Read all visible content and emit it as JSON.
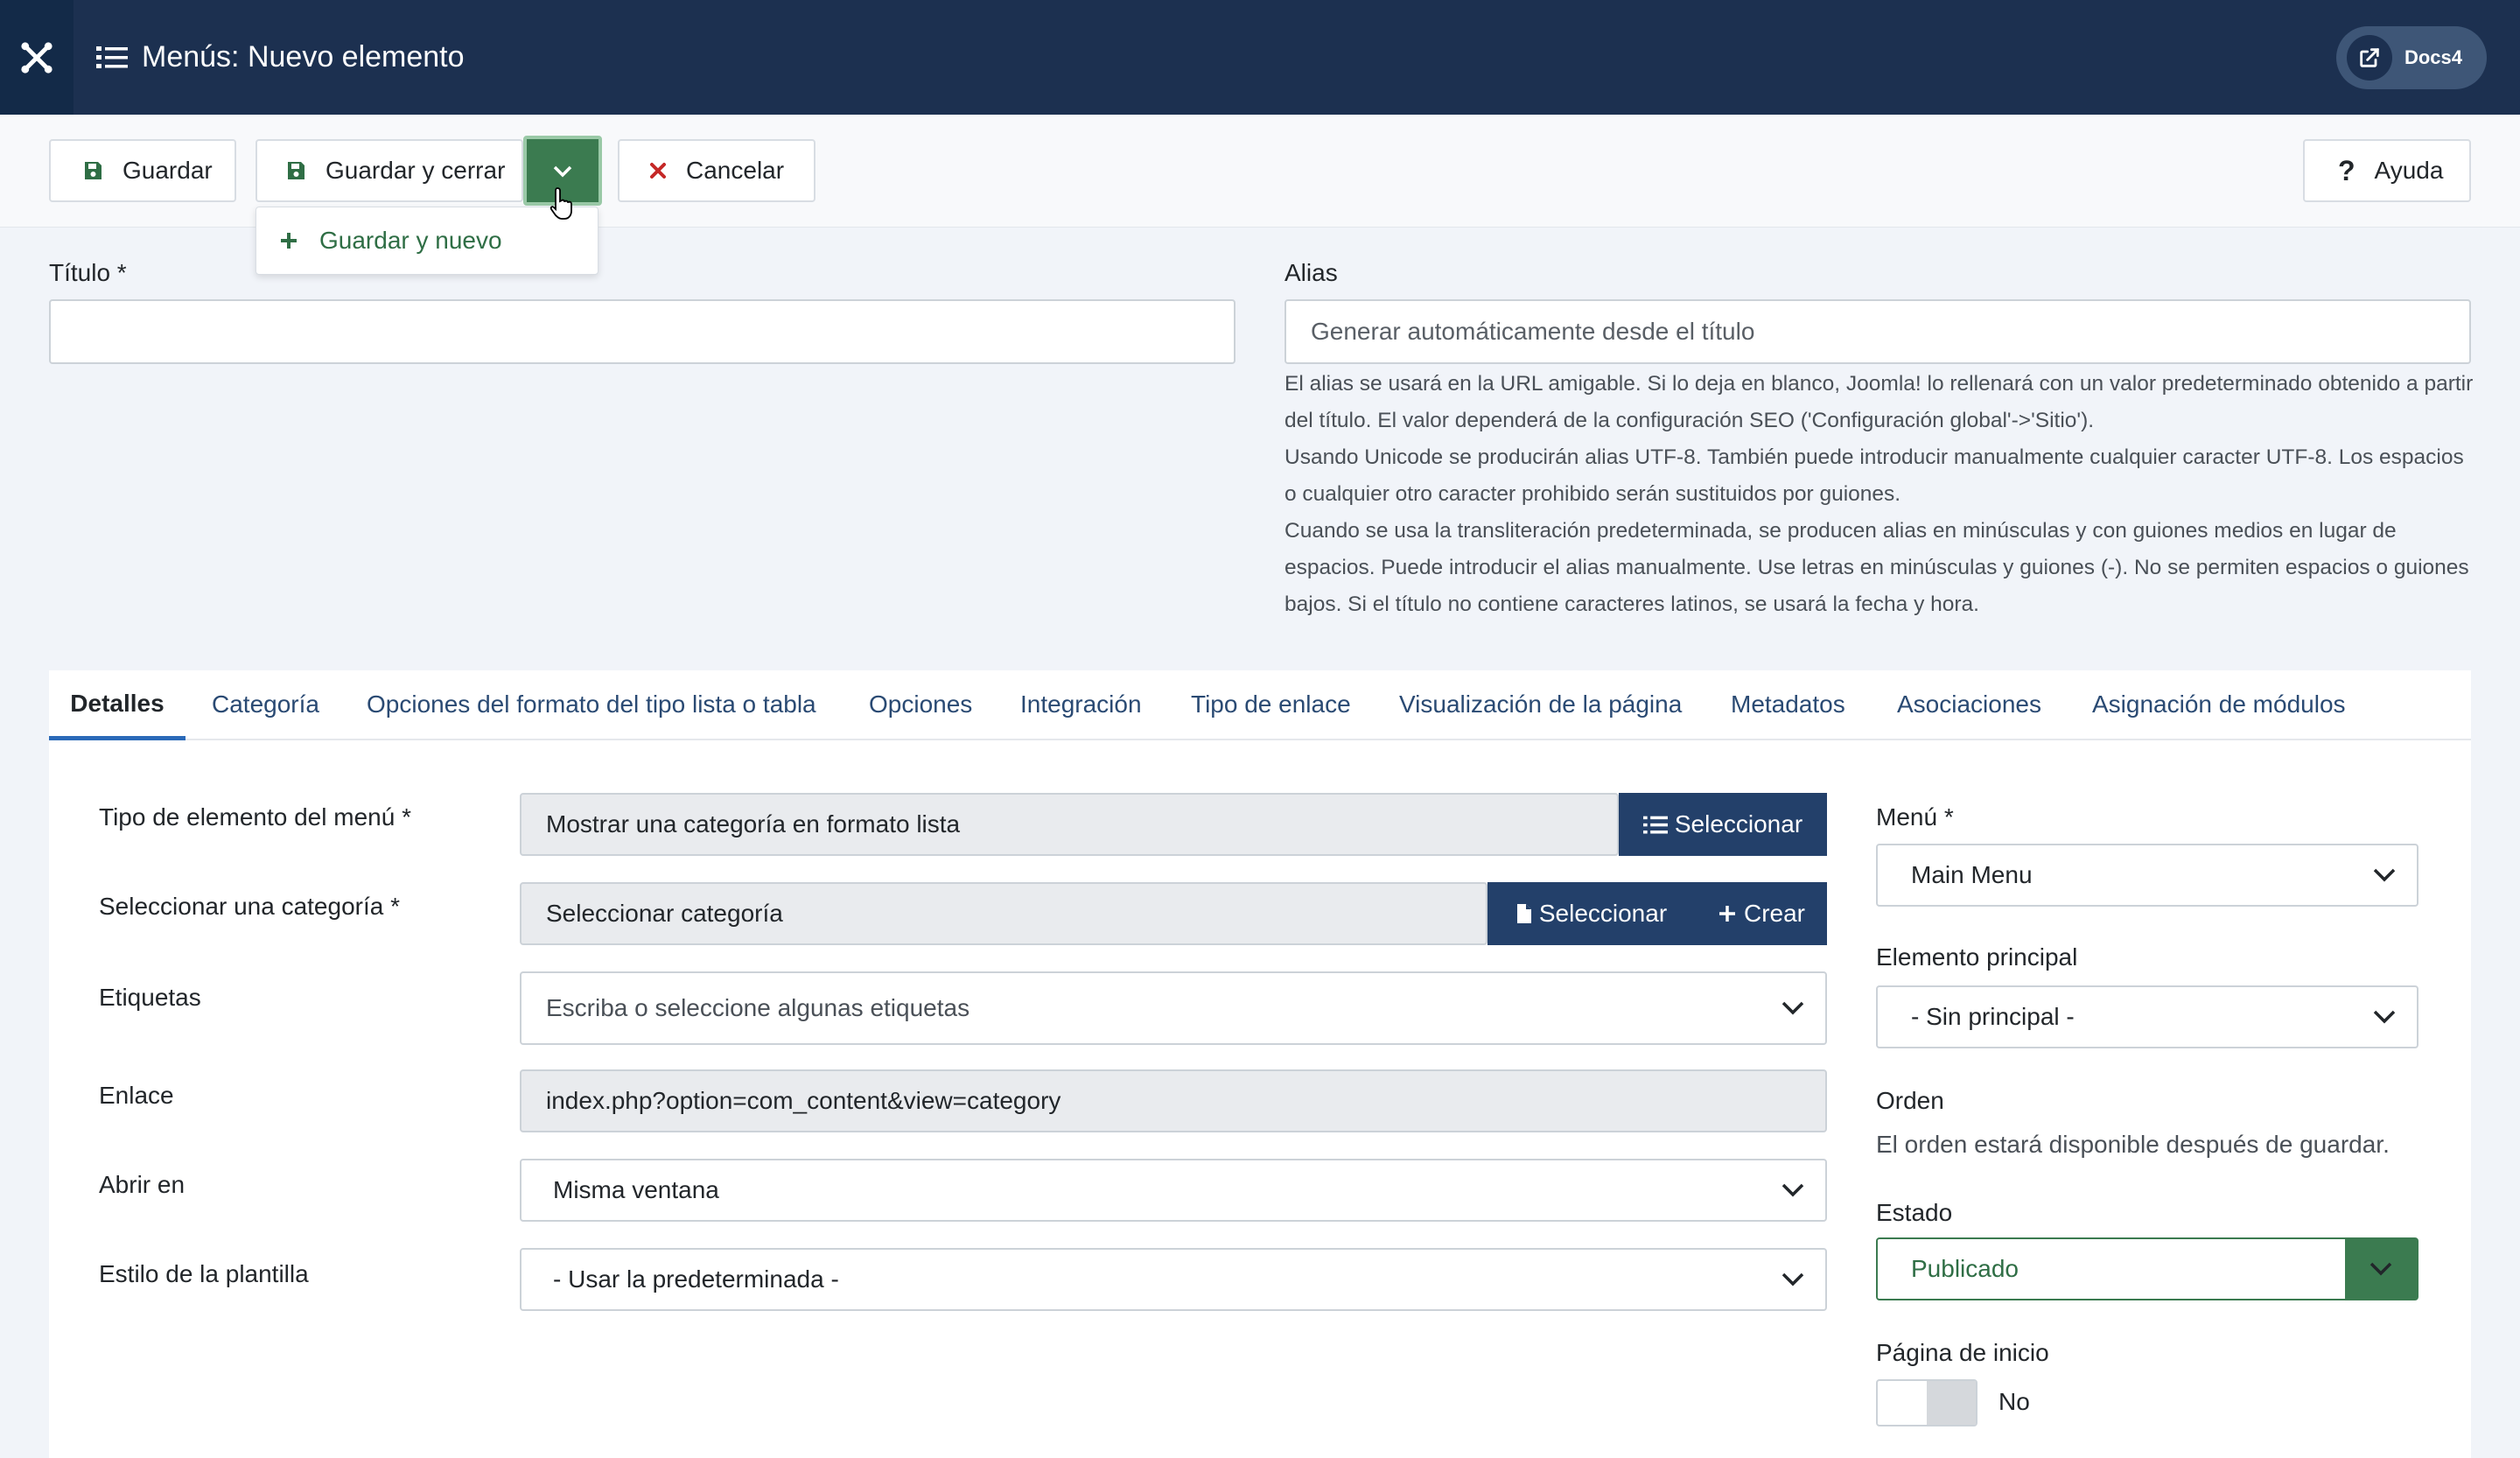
{
  "header": {
    "title": "Menús: Nuevo elemento",
    "docs_label": "Docs4"
  },
  "toolbar": {
    "save_label": "Guardar",
    "save_close_label": "Guardar y cerrar",
    "cancel_label": "Cancelar",
    "help_label": "Ayuda",
    "dropdown_item": "Guardar y nuevo"
  },
  "form": {
    "title_label": "Título *",
    "title_value": "",
    "alias_label": "Alias",
    "alias_placeholder": "Generar automáticamente desde el título",
    "alias_help": [
      "El alias se usará en la URL amigable. Si lo deja en blanco, Joomla! lo rellenará con un valor predeterminado obtenido a partir del título. El valor dependerá de la configuración SEO ('Configuración global'->'Sitio').",
      "Usando Unicode se producirán alias UTF-8. También puede introducir manualmente cualquier caracter UTF-8. Los espacios o cualquier otro caracter prohibido serán sustituidos por guiones.",
      "Cuando se usa la transliteración predeterminada, se producen alias en minúsculas y con guiones medios en lugar de espacios. Puede introducir el alias manualmente. Use letras en minúsculas y guiones (-). No se permiten espacios o guiones bajos. Si el título no contiene caracteres latinos, se usará la fecha y hora."
    ]
  },
  "tabs": [
    "Detalles",
    "Categoría",
    "Opciones del formato del tipo lista o tabla",
    "Opciones",
    "Integración",
    "Tipo de enlace",
    "Visualización de la página",
    "Metadatos",
    "Asociaciones",
    "Asignación de módulos"
  ],
  "details": {
    "menu_type_label": "Tipo de elemento del menú *",
    "menu_type_value": "Mostrar una categoría en formato lista",
    "select_label": "Seleccionar",
    "category_label": "Seleccionar una categoría *",
    "category_value": "Seleccionar categoría",
    "create_label": "Crear",
    "tags_label": "Etiquetas",
    "tags_placeholder": "Escriba o seleccione algunas etiquetas",
    "link_label": "Enlace",
    "link_value": "index.php?option=com_content&view=category",
    "open_label": "Abrir en",
    "open_value": "Misma ventana",
    "template_label": "Estilo de la plantilla",
    "template_value": "- Usar la predeterminada -"
  },
  "sidebar": {
    "menu_label": "Menú *",
    "menu_value": "Main Menu",
    "parent_label": "Elemento principal",
    "parent_value": "- Sin principal -",
    "order_label": "Orden",
    "order_note": "El orden estará disponible después de guardar.",
    "status_label": "Estado",
    "status_value": "Publicado",
    "home_label": "Página de inicio",
    "home_value": "No"
  },
  "colors": {
    "header_bg": "#1c3050",
    "accent_green": "#3b7b50",
    "accent_blue": "#23406a"
  }
}
